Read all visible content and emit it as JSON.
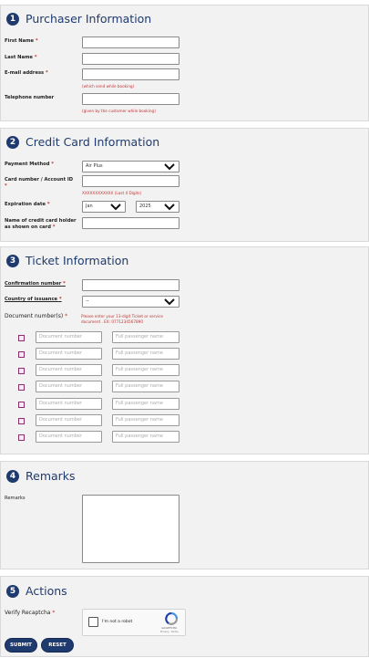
{
  "purchaser": {
    "number": "1",
    "title": "Purchaser Information",
    "first_name_label": "First Name",
    "last_name_label": "Last Name",
    "email_label": "E-mail address",
    "email_hint": "(which send while booking)",
    "phone_label": "Telephone number",
    "phone_hint": "(given by the customer while booking)",
    "required_mark": "*"
  },
  "credit_card": {
    "number": "2",
    "title": "Credit Card Information",
    "payment_method_label": "Payment Method",
    "payment_method_value": "Air Plus",
    "card_number_label": "Card number / Account ID",
    "card_number_hint": "XXXXXXXXXXXX (Last 4 Digits)",
    "expiration_label": "Expiration date",
    "exp_month_value": "Jan",
    "exp_year_value": "2025",
    "holder_label_line1": "Name of credit card holder",
    "holder_label_line2": "as shown on card"
  },
  "ticket": {
    "number": "3",
    "title": "Ticket Information",
    "confirmation_label": "Confirmation number",
    "country_label": "Country of issuance",
    "country_value": "--",
    "doc_numbers_label": "Document number(s)",
    "doc_hint_line1": "Please enter your 13-digit Ticket or service",
    "doc_hint_line2": "document . EX: 0771234567890",
    "doc_placeholder": "Document number",
    "name_placeholder": "Full passenger name"
  },
  "remarks": {
    "number": "4",
    "title": "Remarks",
    "remarks_label": "Remarks"
  },
  "actions": {
    "number": "5",
    "title": "Actions",
    "recaptcha_label": "Verify Recaptcha",
    "captcha_text": "I'm not a robot",
    "captcha_brand": "reCAPTCHA",
    "captcha_links": "Privacy - Terms",
    "submit_label": "SUBMIT",
    "reset_label": "RESET"
  },
  "colors": {
    "accent": "#1f3a6e",
    "required": "#c03535",
    "section_bg": "#f2f2f2"
  }
}
